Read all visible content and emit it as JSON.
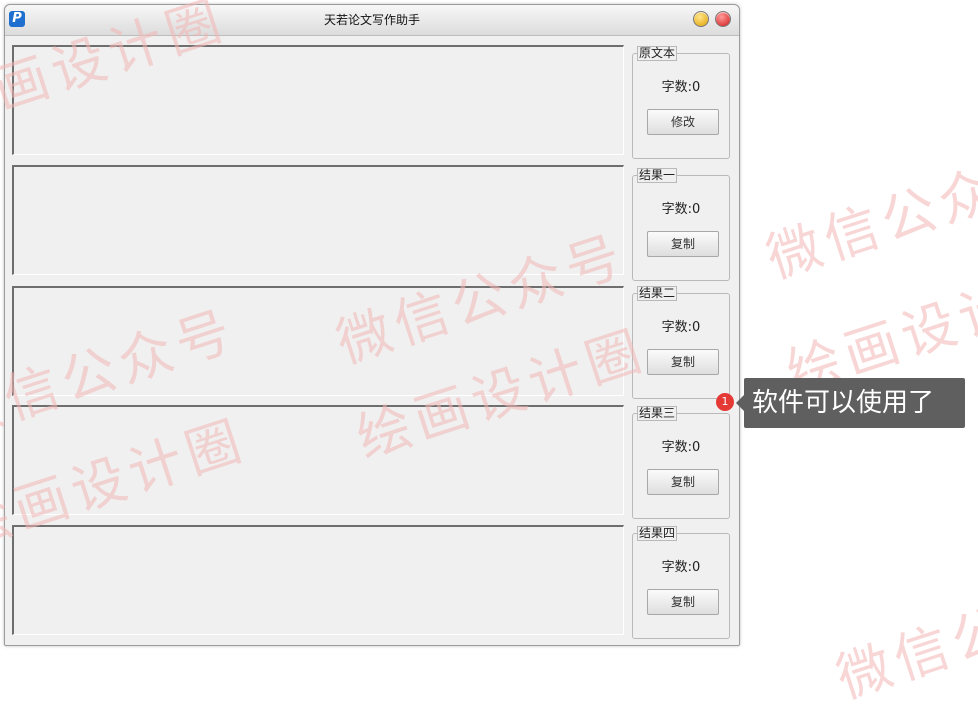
{
  "window": {
    "title": "天若论文写作助手",
    "icon_letter": "P"
  },
  "sections": [
    {
      "group_title": "原文本",
      "count_label": "字数:0",
      "button_label": "修改"
    },
    {
      "group_title": "结果一",
      "count_label": "字数:0",
      "button_label": "复制"
    },
    {
      "group_title": "结果二",
      "count_label": "字数:0",
      "button_label": "复制"
    },
    {
      "group_title": "结果三",
      "count_label": "字数:0",
      "button_label": "复制"
    },
    {
      "group_title": "结果四",
      "count_label": "字数:0",
      "button_label": "复制"
    }
  ],
  "annotation": {
    "badge": "1",
    "text": "软件可以使用了"
  },
  "watermark": {
    "line1": "微信公众号",
    "line2": "绘画设计圈"
  },
  "colors": {
    "badge": "#e53935",
    "tooltip_bg": "#5f5f5f",
    "window_bg": "#f0f0f0",
    "watermark": "#f3b6b6"
  }
}
